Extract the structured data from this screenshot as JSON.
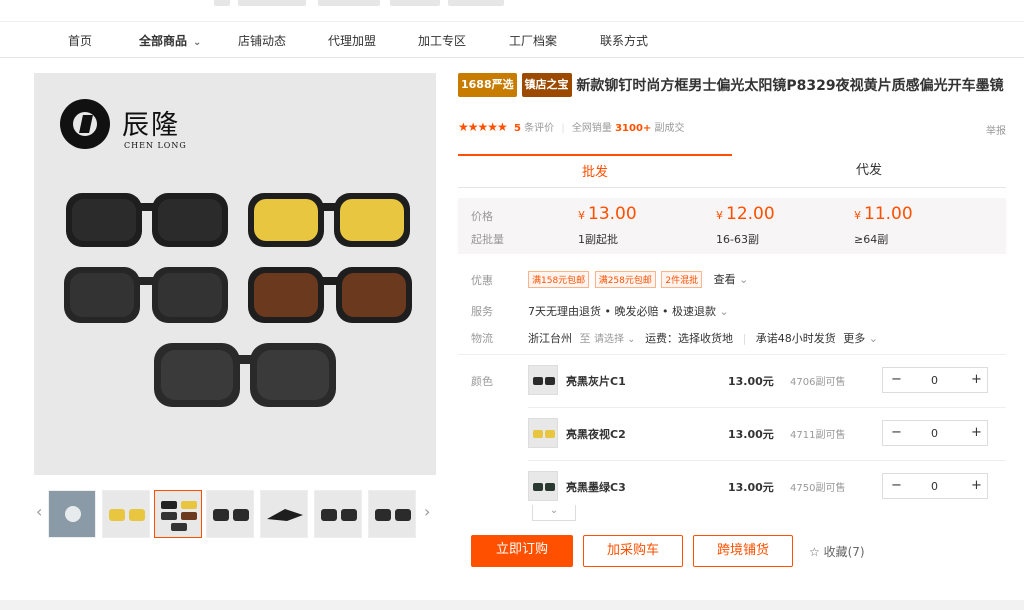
{
  "nav": {
    "items": [
      "首页",
      "全部商品",
      "店铺动态",
      "代理加盟",
      "加工专区",
      "工厂档案",
      "联系方式"
    ]
  },
  "brand": {
    "name_cn": "辰隆",
    "name_en": "CHEN LONG"
  },
  "product": {
    "badge1": "1688严选",
    "badge2": "镇店之宝",
    "title": "新款铆钉时尚方框男士偏光太阳镜P8329夜视黄片质感偏光开车墨镜",
    "rating_count": "5",
    "rating_label": "条评价",
    "sales_label": "全网销量",
    "sales_value": "3100+",
    "sales_unit": "副成交",
    "report": "举报"
  },
  "tabs": [
    "批发",
    "代发"
  ],
  "pricing": {
    "price_label": "价格",
    "qty_label": "起批量",
    "currency": "¥",
    "tiers": [
      {
        "price": "13.00",
        "qty": "1副起批"
      },
      {
        "price": "12.00",
        "qty": "16-63副"
      },
      {
        "price": "11.00",
        "qty": "≥64副"
      }
    ]
  },
  "promo": {
    "label": "优惠",
    "tags": [
      "满158元包邮",
      "满258元包邮",
      "2件混批"
    ],
    "more": "查看"
  },
  "service": {
    "label": "服务",
    "text": "7天无理由退货 • 晚发必赔 • 极速退款"
  },
  "logistics": {
    "label": "物流",
    "origin": "浙江台州",
    "to": "至",
    "select": "请选择",
    "freight": "运费：选择收货地",
    "promise": "承诺48小时发货",
    "more": "更多"
  },
  "sku": {
    "label": "颜色",
    "price_unit": "元",
    "stock_unit": "副可售",
    "items": [
      {
        "name": "亮黑灰片C1",
        "price": "13.00",
        "stock": "4706",
        "qty": "0"
      },
      {
        "name": "亮黑夜视C2",
        "price": "13.00",
        "stock": "4711",
        "qty": "0"
      },
      {
        "name": "亮黑墨绿C3",
        "price": "13.00",
        "stock": "4750",
        "qty": "0"
      }
    ]
  },
  "actions": {
    "buy": "立即订购",
    "cart": "加采购车",
    "cross": "跨境铺货",
    "fav": "收藏(7)"
  },
  "colors": {
    "accent": "#ff5000",
    "lens_dark": "#2b2b2b",
    "lens_yellow": "#e8c640",
    "lens_brown": "#6b3a1e"
  }
}
